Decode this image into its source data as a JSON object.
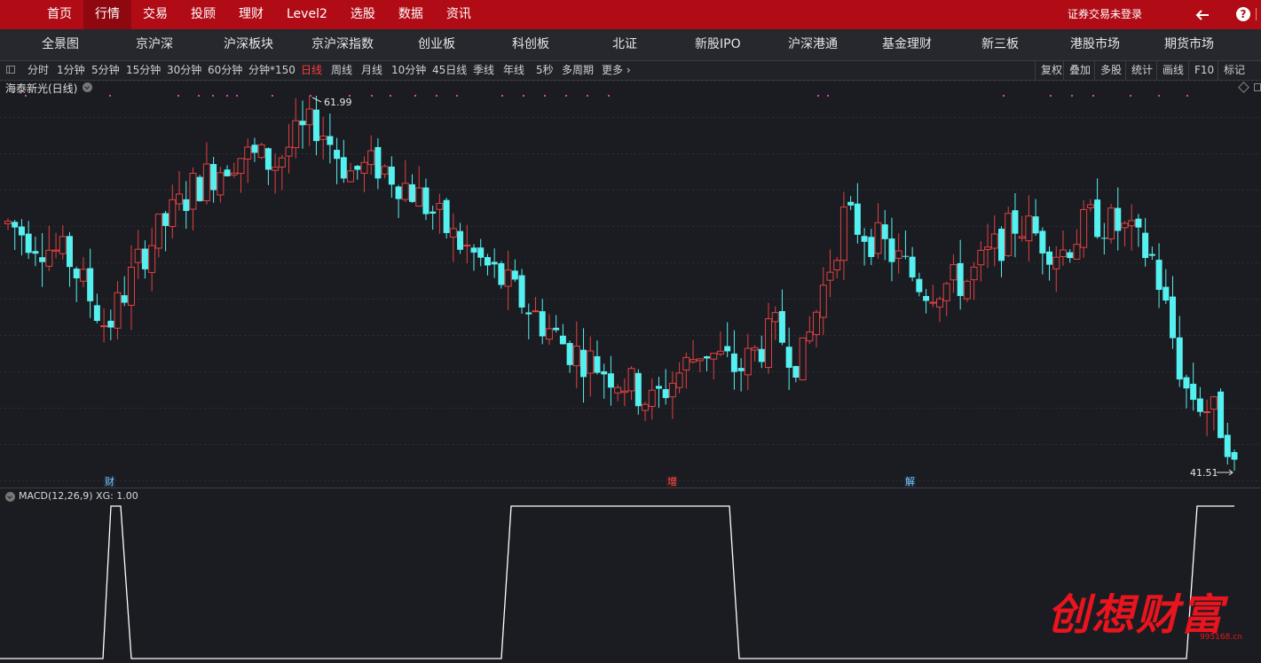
{
  "topnav": [
    "首页",
    "行情",
    "交易",
    "投顾",
    "理财",
    "Level2",
    "选股",
    "数据",
    "资讯"
  ],
  "topnav_active": 1,
  "login_text": "证券交易未登录",
  "market_tabs": [
    "全景图",
    "京沪深",
    "沪深板块",
    "京沪深指数",
    "创业板",
    "科创板",
    "北证",
    "新股IPO",
    "沪深港通",
    "基金理财",
    "新三板",
    "港股市场",
    "期货市场"
  ],
  "periods": [
    "分时",
    "1分钟",
    "5分钟",
    "15分钟",
    "30分钟",
    "60分钟",
    "分钟*150",
    "日线",
    "周线",
    "月线",
    "10分钟",
    "45日线",
    "季线",
    "年线",
    "5秒",
    "多周期",
    "更多"
  ],
  "period_selected": "日线",
  "tools": [
    "复权",
    "叠加",
    "多股",
    "统计",
    "画线",
    "F10",
    "标记"
  ],
  "stock_title": "海泰新光(日线)",
  "price_high": "61.99",
  "price_low": "41.51",
  "events": {
    "fin": "财",
    "add": "增",
    "unl": "解"
  },
  "macd_label": "MACD(12,26,9)  XG: 1.00",
  "watermark": "创想财富",
  "watermark_url": "995168.cn",
  "colors": {
    "up": "#e04141",
    "down": "#55f0f0",
    "bg": "#1b1c21",
    "topbar": "#b10c16",
    "marker": "#e040c0"
  }
}
